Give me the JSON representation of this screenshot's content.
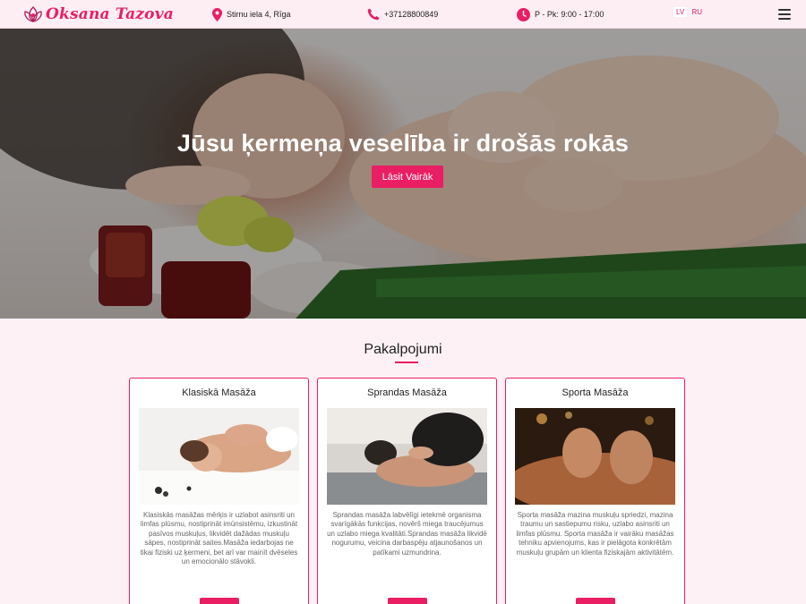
{
  "header": {
    "logo_text": "Oksana Tazova",
    "address": "Stirnu iela 4, Rīga",
    "phone": "+37128800849",
    "hours": "P - Pk: 9:00 - 17:00",
    "lang_lv": "LV",
    "lang_ru": "RU",
    "icons": [
      "lotus-logo-icon",
      "map-pin-icon",
      "phone-icon",
      "clock-icon",
      "hamburger-menu-icon"
    ]
  },
  "hero": {
    "title": "Jūsu ķermeņa veselība ir drošās rokās",
    "button_label": "Lāsit Vairāk"
  },
  "services": {
    "title": "Pakalpojumi",
    "cards": [
      {
        "title": "Klasiskā Masāža",
        "text": "Klasiskās masāžas mērķis ir uzlabot asinsriti un limfas plūsmu, nostiprināt imūnsistēmu, izkustināt pasīvos muskuļus, likvidēt dažādas muskuļu sāpes, nostiprināt saites.Masāža iedarbojas ne tikai fiziski uz ķermeni, bet arī var mainīt dvēseles un emocionālo stāvokli."
      },
      {
        "title": "Sprandas Masāža",
        "text": "Sprandas masāža labvēlīgi ietekmē organisma svarīgākās funkcijas, novērš miega traucējumus un uzlabo miega kvalitāti.Sprandas masāža likvidē nogurumu, veicina darbaspēju atjaunošanos un patīkami uzmundrina."
      },
      {
        "title": "Sporta Masāža",
        "text": "Sporta masāža mazina muskuļu spriedzi, mazina traumu un sastiepumu risku, uzlabo asinsriti un limfas plūsmu. Sporta masāža ir vairāku masāžas tehniku apvienojums, kas ir pielāgota konkrētām muskuļu grupām un klienta fiziskajām aktivitātēm."
      }
    ]
  },
  "colors": {
    "accent": "#e91e63",
    "header_bg": "#fdeef4",
    "page_bg": "#fdf1f6"
  }
}
